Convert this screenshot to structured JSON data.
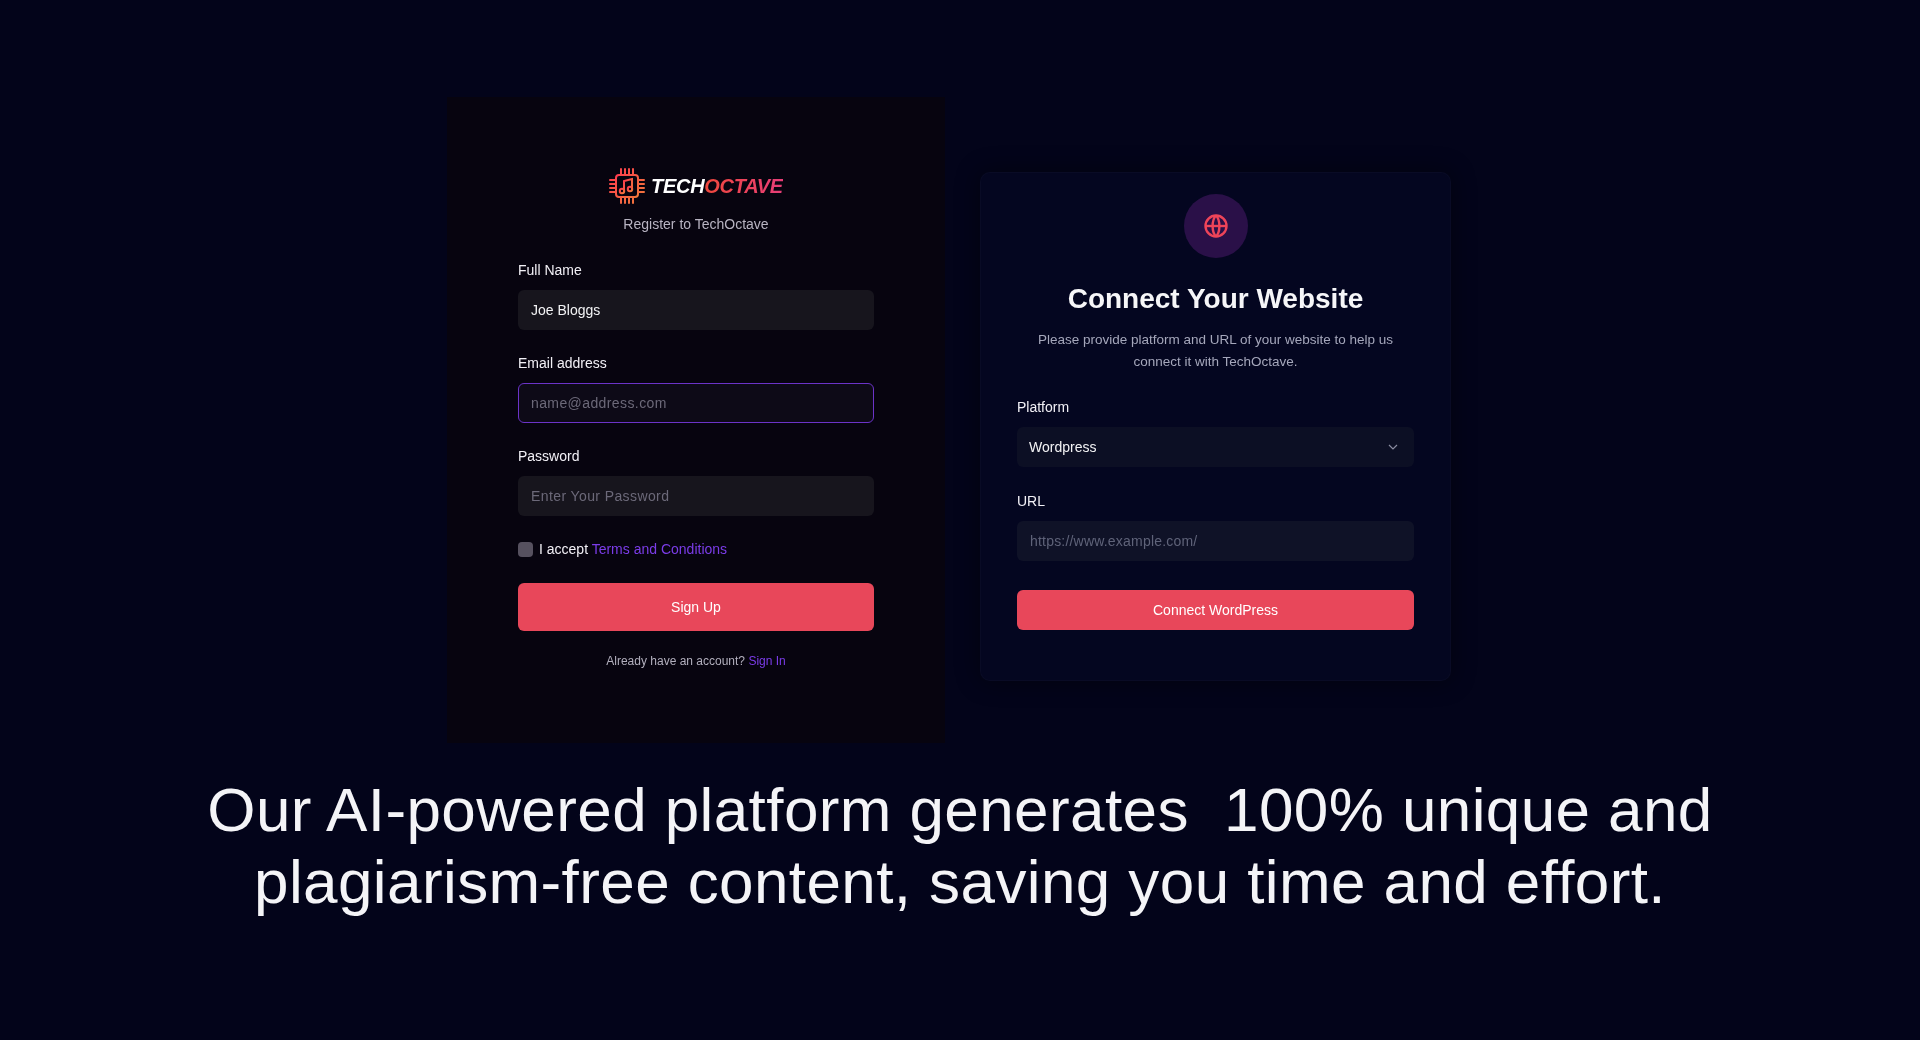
{
  "signup_card": {
    "logo": {
      "word_1": "TECH",
      "word_2": "OCTAVE"
    },
    "subtitle": "Register to TechOctave",
    "fields": [
      {
        "label": "Full Name",
        "value": "Joe Bloggs",
        "focused": false
      },
      {
        "label": "Email address",
        "placeholder": "name@address.com",
        "focused": true
      },
      {
        "label": "Password",
        "placeholder": "Enter Your Password",
        "focused": false
      }
    ],
    "terms": {
      "checked": false,
      "text": "I accept",
      "link": "Terms and Conditions"
    },
    "submit_button": "Sign Up",
    "footer": {
      "text": "Already have an account?",
      "link": "Sign In"
    }
  },
  "connect_card": {
    "title": "Connect Your Website",
    "description": "Please provide platform and URL of your website to help us connect it with TechOctave.",
    "platform": {
      "label": "Platform",
      "value": "Wordpress"
    },
    "url": {
      "label": "URL",
      "placeholder": "https://www.example.com/"
    },
    "submit_button": "Connect WordPress"
  },
  "headline": "Our AI-powered platform generates  100% unique and plagiarism-free content, saving you time and effort."
}
